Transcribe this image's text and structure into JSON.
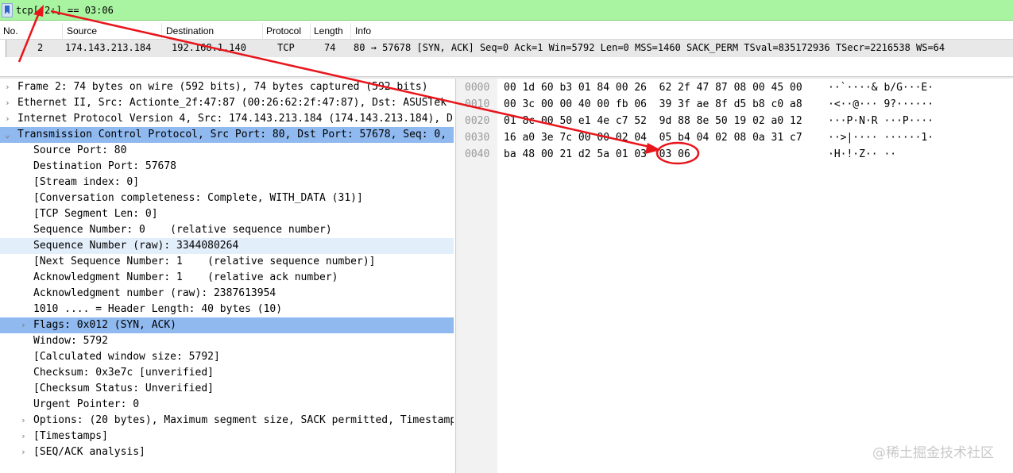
{
  "filter": {
    "expression": "tcp[-2:] == 03:06"
  },
  "packet_list": {
    "columns": [
      "No.",
      "Source",
      "Destination",
      "Protocol",
      "Length",
      "Info"
    ],
    "rows": [
      {
        "no": "2",
        "source": "174.143.213.184",
        "destination": "192.168.1.140",
        "protocol": "TCP",
        "length": "74",
        "info": "80 → 57678 [SYN, ACK] Seq=0 Ack=1 Win=5792 Len=0 MSS=1460 SACK_PERM TSval=835172936 TSecr=2216538 WS=64"
      }
    ]
  },
  "details": {
    "rows": [
      {
        "arrow": "›",
        "text": "Frame 2: 74 bytes on wire (592 bits), 74 bytes captured (592 bits)",
        "indent": 0,
        "state": ""
      },
      {
        "arrow": "›",
        "text": "Ethernet II, Src: Actionte_2f:47:87 (00:26:62:2f:47:87), Dst: ASUSTek",
        "indent": 0,
        "state": ""
      },
      {
        "arrow": "›",
        "text": "Internet Protocol Version 4, Src: 174.143.213.184 (174.143.213.184), D",
        "indent": 0,
        "state": ""
      },
      {
        "arrow": "⌄",
        "text": "Transmission Control Protocol, Src Port: 80, Dst Port: 57678, Seq: 0,",
        "indent": 0,
        "state": "strong"
      },
      {
        "arrow": "",
        "text": "Source Port: 80",
        "indent": 1,
        "state": ""
      },
      {
        "arrow": "",
        "text": "Destination Port: 57678",
        "indent": 1,
        "state": ""
      },
      {
        "arrow": "",
        "text": "[Stream index: 0]",
        "indent": 1,
        "state": ""
      },
      {
        "arrow": "",
        "text": "[Conversation completeness: Complete, WITH_DATA (31)]",
        "indent": 1,
        "state": ""
      },
      {
        "arrow": "",
        "text": "[TCP Segment Len: 0]",
        "indent": 1,
        "state": ""
      },
      {
        "arrow": "",
        "text": "Sequence Number: 0    (relative sequence number)",
        "indent": 1,
        "state": ""
      },
      {
        "arrow": "",
        "text": "Sequence Number (raw): 3344080264",
        "indent": 1,
        "state": "light"
      },
      {
        "arrow": "",
        "text": "[Next Sequence Number: 1    (relative sequence number)]",
        "indent": 1,
        "state": ""
      },
      {
        "arrow": "",
        "text": "Acknowledgment Number: 1    (relative ack number)",
        "indent": 1,
        "state": ""
      },
      {
        "arrow": "",
        "text": "Acknowledgment number (raw): 2387613954",
        "indent": 1,
        "state": ""
      },
      {
        "arrow": "",
        "text": "1010 .... = Header Length: 40 bytes (10)",
        "indent": 1,
        "state": ""
      },
      {
        "arrow": "›",
        "text": "Flags: 0x012 (SYN, ACK)",
        "indent": 1,
        "state": "strong"
      },
      {
        "arrow": "",
        "text": "Window: 5792",
        "indent": 1,
        "state": ""
      },
      {
        "arrow": "",
        "text": "[Calculated window size: 5792]",
        "indent": 1,
        "state": ""
      },
      {
        "arrow": "",
        "text": "Checksum: 0x3e7c [unverified]",
        "indent": 1,
        "state": ""
      },
      {
        "arrow": "",
        "text": "[Checksum Status: Unverified]",
        "indent": 1,
        "state": ""
      },
      {
        "arrow": "",
        "text": "Urgent Pointer: 0",
        "indent": 1,
        "state": ""
      },
      {
        "arrow": "›",
        "text": "Options: (20 bytes), Maximum segment size, SACK permitted, Timestamps",
        "indent": 1,
        "state": ""
      },
      {
        "arrow": "›",
        "text": "[Timestamps]",
        "indent": 1,
        "state": ""
      },
      {
        "arrow": "›",
        "text": "[SEQ/ACK analysis]",
        "indent": 1,
        "state": ""
      }
    ]
  },
  "hex": {
    "rows": [
      {
        "offset": "0000",
        "bytes": "00 1d 60 b3 01 84 00 26  62 2f 47 87 08 00 45 00",
        "ascii": "··`····& b/G···E·"
      },
      {
        "offset": "0010",
        "bytes": "00 3c 00 00 40 00 fb 06  39 3f ae 8f d5 b8 c0 a8",
        "ascii": "·<··@··· 9?······"
      },
      {
        "offset": "0020",
        "bytes": "01 8c 00 50 e1 4e c7 52  9d 88 8e 50 19 02 a0 12",
        "ascii": "···P·N·R ···P····"
      },
      {
        "offset": "0030",
        "bytes": "16 a0 3e 7c 00 00 02 04  05 b4 04 02 08 0a 31 c7",
        "ascii": "··>|···· ······1·"
      },
      {
        "offset": "0040",
        "bytes": "ba 48 00 21 d2 5a 01 03  03 06",
        "ascii": "·H·!·Z·· ··"
      }
    ]
  },
  "watermark": "@稀土掘金技术社区",
  "colors": {
    "filter_bg": "#a9f4a1",
    "selected_strong": "#8fb9ef",
    "selected_light": "#e3eefb",
    "annotation_red": "#e8151b"
  }
}
